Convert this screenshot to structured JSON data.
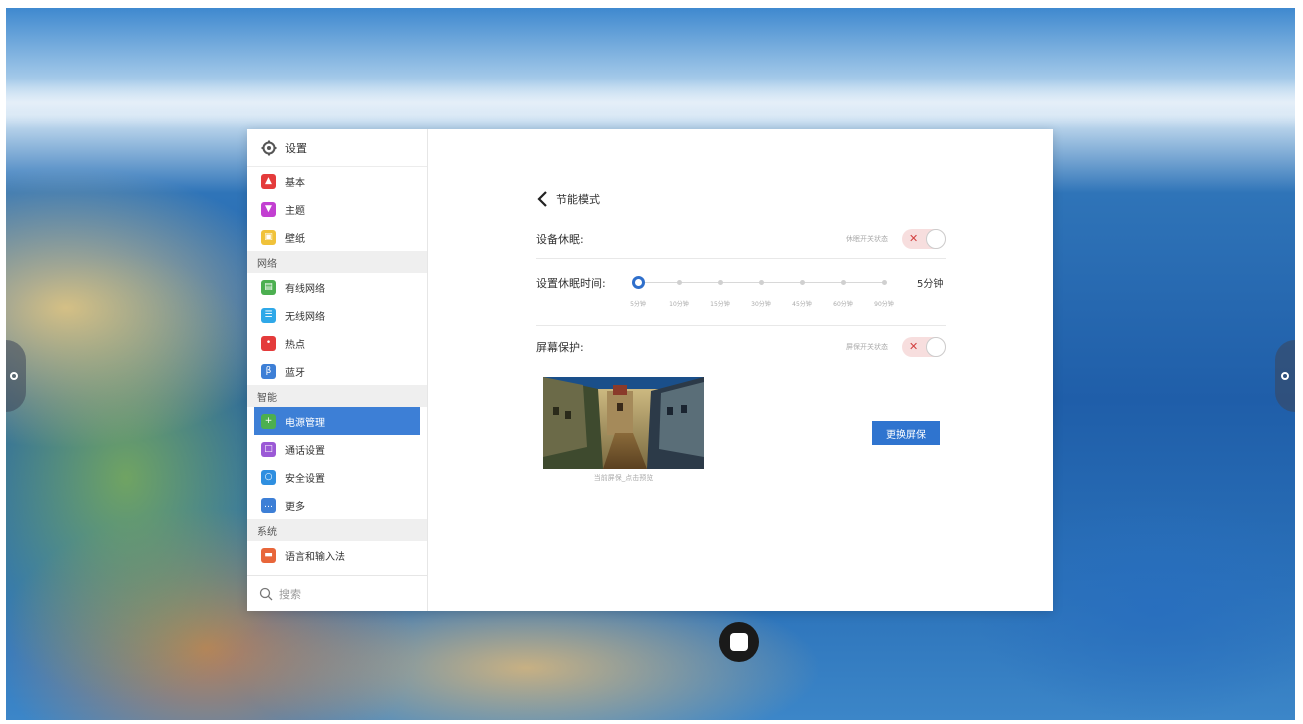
{
  "sidebar": {
    "title": "设置",
    "items": [
      {
        "type": "item",
        "label": "基本",
        "icon": "basic-icon",
        "color": "#e43b3b",
        "glyph": "▲"
      },
      {
        "type": "item",
        "label": "主题",
        "icon": "theme-shirt-icon",
        "color": "#c23fd1",
        "glyph": "▼"
      },
      {
        "type": "item",
        "label": "壁纸",
        "icon": "wallpaper-icon",
        "color": "#f0c23a",
        "glyph": "▣"
      },
      {
        "type": "section",
        "label": "网络"
      },
      {
        "type": "item",
        "label": "有线网络",
        "icon": "wired-network-icon",
        "color": "#4caf50",
        "glyph": "▤"
      },
      {
        "type": "item",
        "label": "无线网络",
        "icon": "wifi-icon",
        "color": "#2fa8e8",
        "glyph": "☰"
      },
      {
        "type": "item",
        "label": "热点",
        "icon": "hotspot-icon",
        "color": "#e43b3b",
        "glyph": "•"
      },
      {
        "type": "item",
        "label": "蓝牙",
        "icon": "bluetooth-icon",
        "color": "#3d7fd6",
        "glyph": "β"
      },
      {
        "type": "section",
        "label": "智能"
      },
      {
        "type": "item",
        "label": "电源管理",
        "icon": "power-management-icon",
        "color": "#4caf50",
        "glyph": "+",
        "active": true
      },
      {
        "type": "item",
        "label": "通话设置",
        "icon": "call-settings-icon",
        "color": "#9b59d6",
        "glyph": "□"
      },
      {
        "type": "item",
        "label": "安全设置",
        "icon": "security-icon",
        "color": "#2f8fe0",
        "glyph": "○"
      },
      {
        "type": "item",
        "label": "更多",
        "icon": "more-icon",
        "color": "#3d7fd6",
        "glyph": "…"
      },
      {
        "type": "section",
        "label": "系统"
      },
      {
        "type": "item",
        "label": "语言和输入法",
        "icon": "language-input-icon",
        "color": "#e8663a",
        "glyph": "▬"
      }
    ],
    "search_placeholder": "搜索"
  },
  "content": {
    "back_label": "节能模式",
    "device_sleep": {
      "label": "设备休眠:",
      "hint": "休眠开关状态",
      "enabled": false
    },
    "sleep_time": {
      "label": "设置休眠时间:",
      "value": "5分钟",
      "options": [
        "5分钟",
        "10分钟",
        "15分钟",
        "30分钟",
        "45分钟",
        "60分钟",
        "90分钟"
      ],
      "selected_index": 0
    },
    "screen_saver": {
      "label": "屏幕保护:",
      "hint": "屏保开关状态",
      "enabled": false
    },
    "preview_caption": "当前屏保_点击预览",
    "change_button": "更换屏保"
  },
  "colors": {
    "accent": "#2f74cf",
    "toggle_off_bg": "#f7dede",
    "toggle_x": "#d24040"
  }
}
